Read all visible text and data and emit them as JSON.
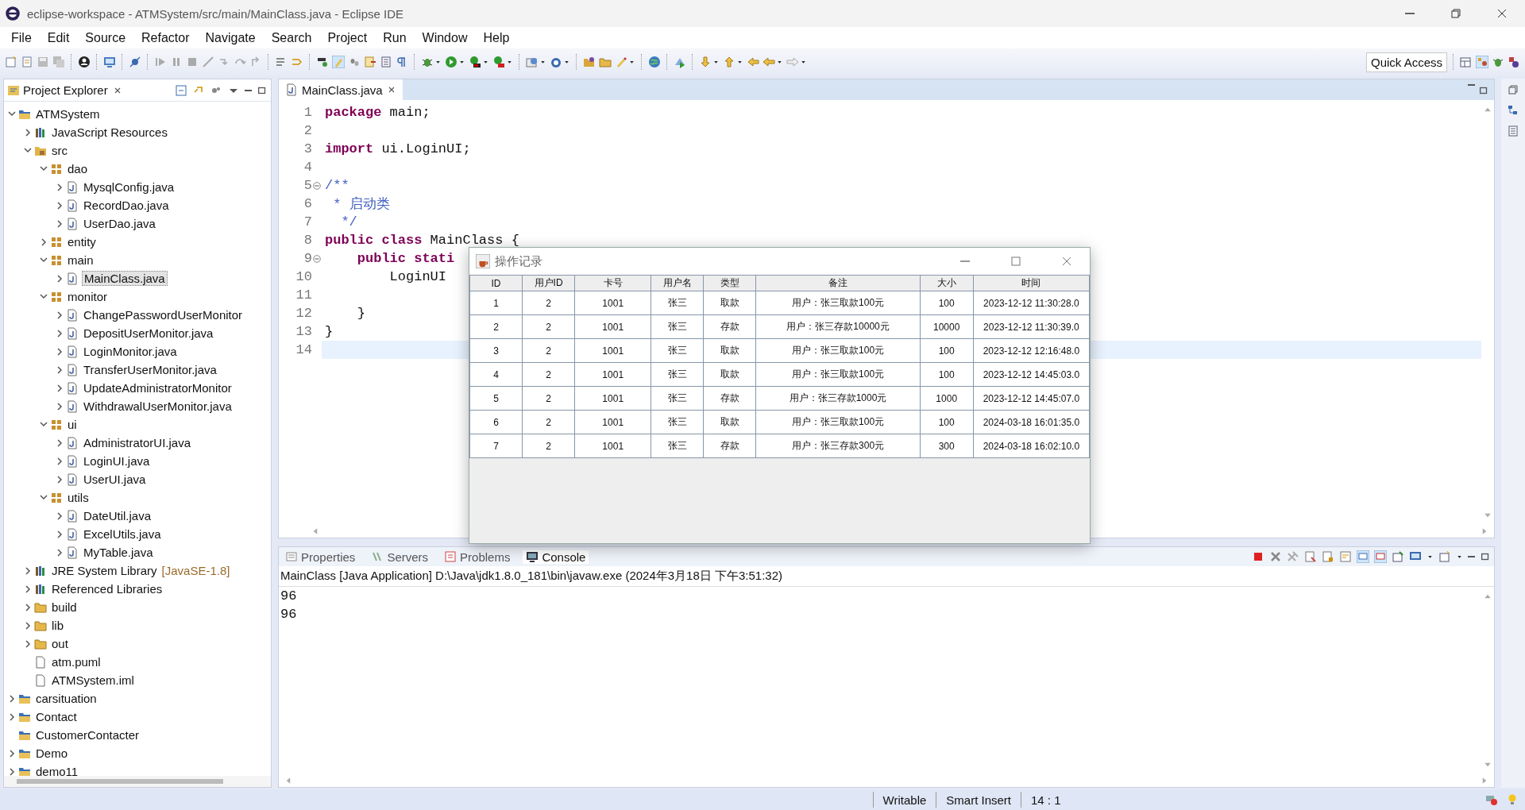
{
  "window": {
    "title": "eclipse-workspace - ATMSystem/src/main/MainClass.java - Eclipse IDE"
  },
  "menu": [
    "File",
    "Edit",
    "Source",
    "Refactor",
    "Navigate",
    "Search",
    "Project",
    "Run",
    "Window",
    "Help"
  ],
  "toolbar": {
    "quick_access": "Quick Access"
  },
  "explorer": {
    "title": "Project Explorer",
    "tree": [
      {
        "label": "ATMSystem",
        "kind": "project",
        "expanded": true,
        "selected": false,
        "children": [
          {
            "label": "JavaScript Resources",
            "kind": "library",
            "expanded": false,
            "selected": false
          },
          {
            "label": "src",
            "kind": "source",
            "expanded": true,
            "selected": false,
            "children": [
              {
                "label": "dao",
                "kind": "package",
                "expanded": true,
                "selected": false,
                "children": [
                  {
                    "label": "MysqlConfig.java",
                    "kind": "java",
                    "expanded": false,
                    "selected": false
                  },
                  {
                    "label": "RecordDao.java",
                    "kind": "java",
                    "expanded": false,
                    "selected": false
                  },
                  {
                    "label": "UserDao.java",
                    "kind": "java",
                    "expanded": false,
                    "selected": false
                  }
                ]
              },
              {
                "label": "entity",
                "kind": "package",
                "expanded": false,
                "selected": false
              },
              {
                "label": "main",
                "kind": "package",
                "expanded": true,
                "selected": false,
                "children": [
                  {
                    "label": "MainClass.java",
                    "kind": "java",
                    "expanded": false,
                    "selected": true
                  }
                ]
              },
              {
                "label": "monitor",
                "kind": "package",
                "expanded": true,
                "selected": false,
                "children": [
                  {
                    "label": "ChangePasswordUserMonitor",
                    "kind": "java",
                    "expanded": false,
                    "selected": false
                  },
                  {
                    "label": "DepositUserMonitor.java",
                    "kind": "java",
                    "expanded": false,
                    "selected": false
                  },
                  {
                    "label": "LoginMonitor.java",
                    "kind": "java",
                    "expanded": false,
                    "selected": false
                  },
                  {
                    "label": "TransferUserMonitor.java",
                    "kind": "java",
                    "expanded": false,
                    "selected": false
                  },
                  {
                    "label": "UpdateAdministratorMonitor",
                    "kind": "java",
                    "expanded": false,
                    "selected": false
                  },
                  {
                    "label": "WithdrawalUserMonitor.java",
                    "kind": "java",
                    "expanded": false,
                    "selected": false
                  }
                ]
              },
              {
                "label": "ui",
                "kind": "package",
                "expanded": true,
                "selected": false,
                "children": [
                  {
                    "label": "AdministratorUI.java",
                    "kind": "java",
                    "expanded": false,
                    "selected": false
                  },
                  {
                    "label": "LoginUI.java",
                    "kind": "java",
                    "expanded": false,
                    "selected": false
                  },
                  {
                    "label": "UserUI.java",
                    "kind": "java",
                    "expanded": false,
                    "selected": false
                  }
                ]
              },
              {
                "label": "utils",
                "kind": "package",
                "expanded": true,
                "selected": false,
                "children": [
                  {
                    "label": "DateUtil.java",
                    "kind": "java",
                    "expanded": false,
                    "selected": false
                  },
                  {
                    "label": "ExcelUtils.java",
                    "kind": "java",
                    "expanded": false,
                    "selected": false
                  },
                  {
                    "label": "MyTable.java",
                    "kind": "java",
                    "expanded": false,
                    "selected": false
                  }
                ]
              }
            ]
          },
          {
            "label": "JRE System Library",
            "decoration": "[JavaSE-1.8]",
            "kind": "library",
            "expanded": false,
            "selected": false
          },
          {
            "label": "Referenced Libraries",
            "kind": "library",
            "expanded": false,
            "selected": false
          },
          {
            "label": "build",
            "kind": "folder",
            "expanded": false,
            "selected": false
          },
          {
            "label": "lib",
            "kind": "folder",
            "expanded": false,
            "selected": false
          },
          {
            "label": "out",
            "kind": "folder",
            "expanded": false,
            "selected": false
          },
          {
            "label": "atm.puml",
            "kind": "file",
            "selected": false
          },
          {
            "label": "ATMSystem.iml",
            "kind": "file",
            "selected": false
          }
        ]
      },
      {
        "label": "carsituation",
        "kind": "project",
        "expanded": false,
        "selected": false
      },
      {
        "label": "Contact",
        "kind": "project",
        "expanded": false,
        "selected": false
      },
      {
        "label": "CustomerContacter",
        "kind": "project",
        "selected": false
      },
      {
        "label": "Demo",
        "kind": "project",
        "expanded": false,
        "selected": false
      },
      {
        "label": "demo11",
        "kind": "project",
        "expanded": false,
        "selected": false
      }
    ]
  },
  "editor": {
    "tab": "MainClass.java",
    "lines": [
      {
        "number": "1",
        "fold": false,
        "current": false,
        "tokens": [
          {
            "kind": "keyword",
            "text": "package"
          },
          {
            "kind": "plain",
            "text": " main;"
          }
        ]
      },
      {
        "number": "2",
        "fold": false,
        "current": false
      },
      {
        "number": "3",
        "fold": false,
        "current": false,
        "tokens": [
          {
            "kind": "keyword",
            "text": "import"
          },
          {
            "kind": "plain",
            "text": " ui.LoginUI;"
          }
        ]
      },
      {
        "number": "4",
        "fold": false,
        "current": false
      },
      {
        "number": "5",
        "fold": true,
        "current": false,
        "tokens": [
          {
            "kind": "doc",
            "text": "/**"
          }
        ]
      },
      {
        "number": "6",
        "fold": false,
        "current": false,
        "tokens": [
          {
            "kind": "doc",
            "text": " * 启动类"
          }
        ]
      },
      {
        "number": "7",
        "fold": false,
        "current": false,
        "tokens": [
          {
            "kind": "doc",
            "text": "  */"
          }
        ]
      },
      {
        "number": "8",
        "fold": false,
        "current": false,
        "tokens": [
          {
            "kind": "keyword",
            "text": "public class"
          },
          {
            "kind": "plain",
            "text": " MainClass {"
          }
        ]
      },
      {
        "number": "9",
        "fold": true,
        "current": false,
        "tokens": [
          {
            "kind": "keyword",
            "text": "    public stati"
          }
        ]
      },
      {
        "number": "10",
        "fold": false,
        "current": false,
        "tokens": [
          {
            "kind": "plain",
            "text": "        LoginUI"
          }
        ]
      },
      {
        "number": "11",
        "fold": false,
        "current": false
      },
      {
        "number": "12",
        "fold": false,
        "current": false,
        "tokens": [
          {
            "kind": "plain",
            "text": "    }"
          }
        ]
      },
      {
        "number": "13",
        "fold": false,
        "current": false,
        "tokens": [
          {
            "kind": "plain",
            "text": "}"
          }
        ]
      },
      {
        "number": "14",
        "fold": false,
        "current": true
      }
    ]
  },
  "bottom_panel": {
    "tabs": [
      {
        "label": "Properties",
        "selected": false
      },
      {
        "label": "Servers",
        "selected": false
      },
      {
        "label": "Problems",
        "selected": false
      },
      {
        "label": "Console",
        "selected": true
      }
    ],
    "console": {
      "header": "MainClass [Java Application] D:\\Java\\jdk1.8.0_181\\bin\\javaw.exe (2024年3月18日 下午3:51:32)",
      "output": [
        "96",
        "96"
      ]
    }
  },
  "dialog": {
    "title": "操作记录",
    "columns": [
      "ID",
      "用户ID",
      "卡号",
      "用户名",
      "类型",
      "备注",
      "大小",
      "时间"
    ],
    "rows": [
      [
        "1",
        "2",
        "1001",
        "张三",
        "取款",
        "用户：张三取款100元",
        "100",
        "2023-12-12 11:30:28.0"
      ],
      [
        "2",
        "2",
        "1001",
        "张三",
        "存款",
        "用户：张三存款10000元",
        "10000",
        "2023-12-12 11:30:39.0"
      ],
      [
        "3",
        "2",
        "1001",
        "张三",
        "取款",
        "用户：张三取款100元",
        "100",
        "2023-12-12 12:16:48.0"
      ],
      [
        "4",
        "2",
        "1001",
        "张三",
        "取款",
        "用户：张三取款100元",
        "100",
        "2023-12-12 14:45:03.0"
      ],
      [
        "5",
        "2",
        "1001",
        "张三",
        "存款",
        "用户：张三存款1000元",
        "1000",
        "2023-12-12 14:45:07.0"
      ],
      [
        "6",
        "2",
        "1001",
        "张三",
        "取款",
        "用户：张三取款100元",
        "100",
        "2024-03-18 16:01:35.0"
      ],
      [
        "7",
        "2",
        "1001",
        "张三",
        "存款",
        "用户：张三存款300元",
        "300",
        "2024-03-18 16:02:10.0"
      ]
    ]
  },
  "status_bar": {
    "mode": "Writable",
    "insert": "Smart Insert",
    "position": "14 : 1"
  }
}
